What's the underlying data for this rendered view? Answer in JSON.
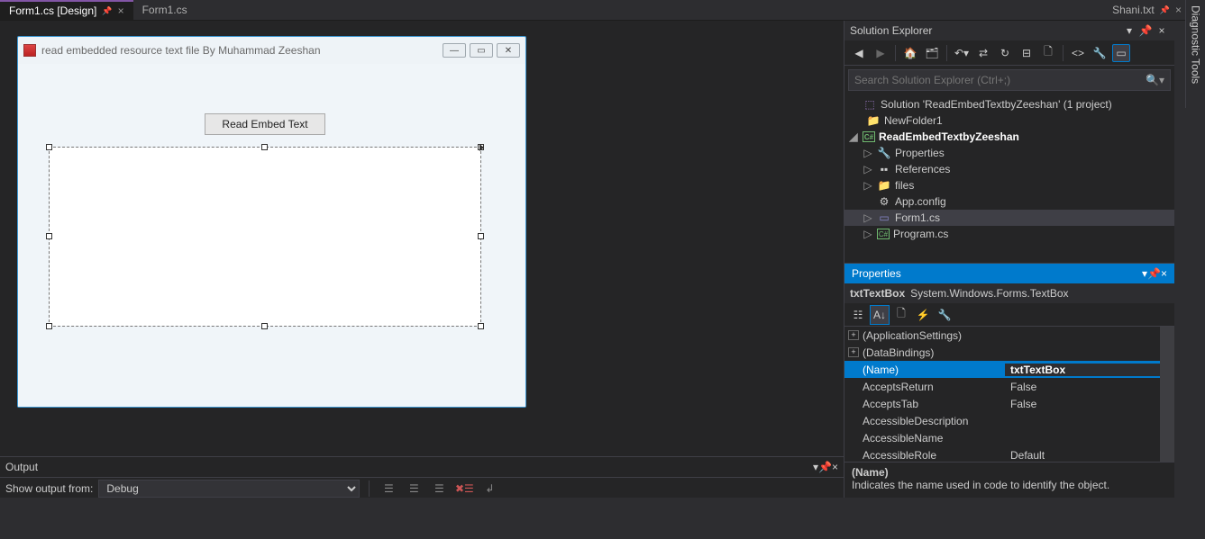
{
  "tabs": {
    "left": [
      {
        "label": "Form1.cs [Design]",
        "active": true
      },
      {
        "label": "Form1.cs",
        "active": false
      }
    ],
    "right": {
      "label": "Shani.txt"
    }
  },
  "winform": {
    "title": "read embedded resource text file By Muhammad Zeeshan",
    "button_label": "Read Embed Text"
  },
  "solution_explorer": {
    "title": "Solution Explorer",
    "search_placeholder": "Search Solution Explorer (Ctrl+;)",
    "nodes": {
      "solution": "Solution 'ReadEmbedTextbyZeeshan' (1 project)",
      "newfolder": "NewFolder1",
      "project": "ReadEmbedTextbyZeeshan",
      "properties": "Properties",
      "references": "References",
      "files": "files",
      "appconfig": "App.config",
      "form1": "Form1.cs",
      "program": "Program.cs"
    }
  },
  "properties": {
    "title": "Properties",
    "object_name": "txtTextBox",
    "object_type": "System.Windows.Forms.TextBox",
    "rows": [
      {
        "name": "(ApplicationSettings)",
        "value": "",
        "expandable": true
      },
      {
        "name": "(DataBindings)",
        "value": "",
        "expandable": true
      },
      {
        "name": "(Name)",
        "value": "txtTextBox",
        "selected": true
      },
      {
        "name": "AcceptsReturn",
        "value": "False"
      },
      {
        "name": "AcceptsTab",
        "value": "False"
      },
      {
        "name": "AccessibleDescription",
        "value": ""
      },
      {
        "name": "AccessibleName",
        "value": ""
      },
      {
        "name": "AccessibleRole",
        "value": "Default"
      }
    ],
    "desc_name": "(Name)",
    "desc_text": "Indicates the name used in code to identify the object."
  },
  "output": {
    "title": "Output",
    "show_from_label": "Show output from:",
    "source": "Debug"
  },
  "vstrip": {
    "label": "Diagnostic Tools"
  }
}
